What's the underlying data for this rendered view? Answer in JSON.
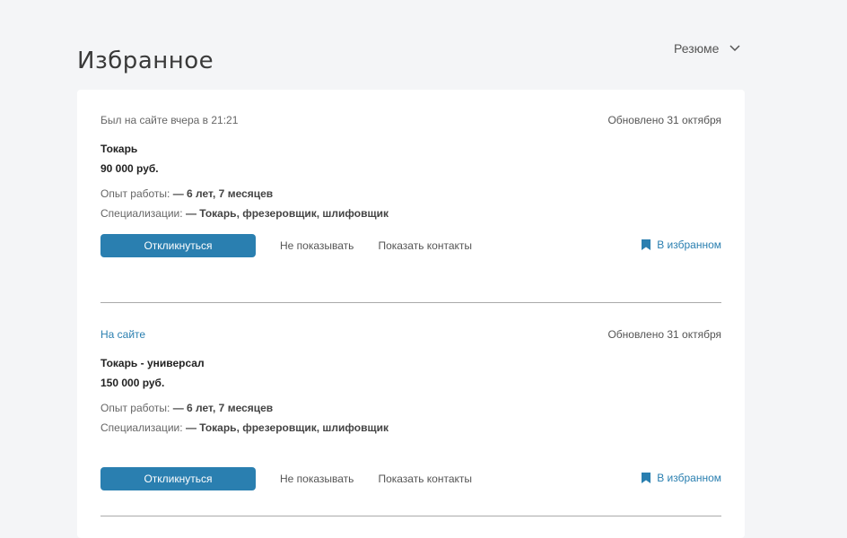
{
  "page": {
    "title": "Избранное"
  },
  "filter": {
    "label": "Резюме"
  },
  "results": [
    {
      "status": "Был на сайте вчера в 21:21",
      "updated": "Обновлено 31 октября",
      "title": "Токарь",
      "salary": "90 000 руб.",
      "experience_label": "Опыт работы:",
      "experience_value": "— 6 лет, 7 месяцев",
      "spec_label": "Специализации:",
      "spec_value": "— Токарь, фрезеровщик, шлифовщик",
      "respond_label": "Откликнуться",
      "hide_label": "Не показывать",
      "contacts_label": "Показать контакты",
      "favorite_label": "В избранном"
    },
    {
      "status": "На сайте",
      "updated": "Обновлено 31 октября",
      "title": "Токарь - универсал",
      "salary": "150 000 руб.",
      "experience_label": "Опыт работы:",
      "experience_value": "— 6 лет, 7 месяцев",
      "spec_label": "Специализации:",
      "spec_value": "— Токарь, фрезеровщик, шлифовщик",
      "respond_label": "Откликнуться",
      "hide_label": "Не показывать",
      "contacts_label": "Показать контакты",
      "favorite_label": "В избранном"
    }
  ],
  "colors": {
    "accent": "#2a7fb0",
    "background": "#f4f5f7",
    "card": "#ffffff"
  }
}
